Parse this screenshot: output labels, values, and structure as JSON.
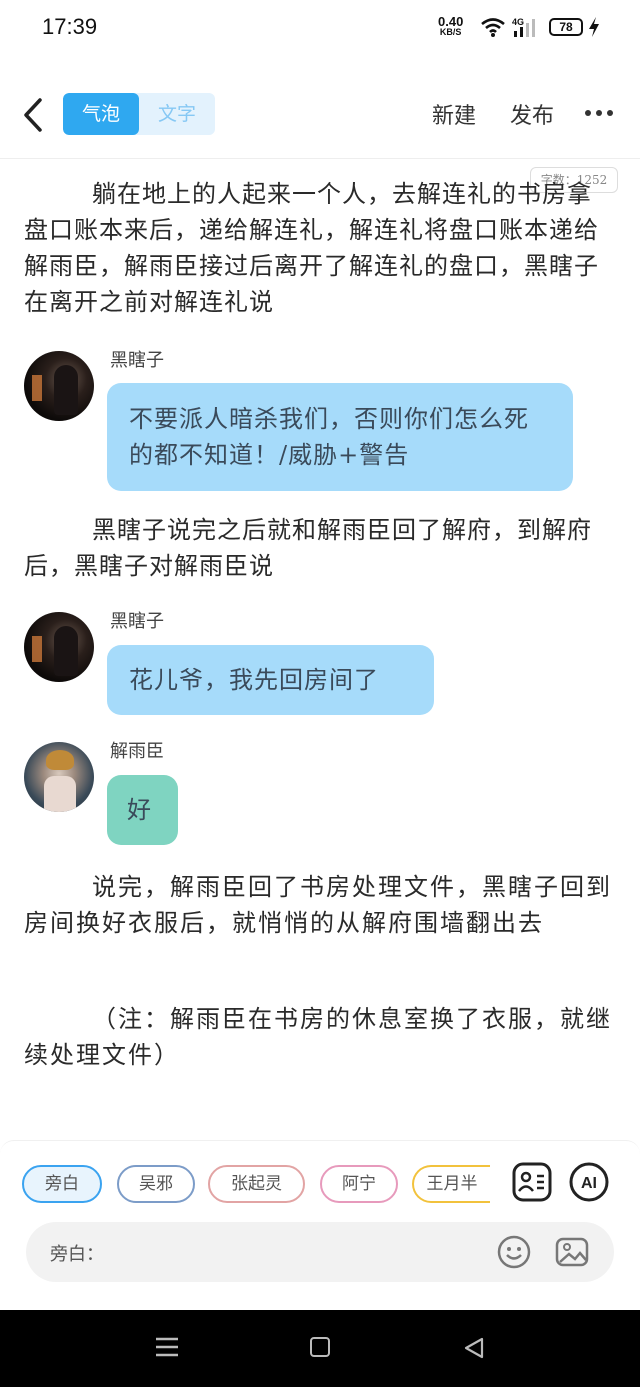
{
  "status_bar": {
    "time": "17:39",
    "net_speed": "0.40",
    "net_unit": "KB/S",
    "net_type": "4G",
    "battery": "78"
  },
  "header": {
    "tab_bubble": "气泡",
    "tab_text": "文字",
    "new_label": "新建",
    "publish_label": "发布"
  },
  "word_count": "字数：1252",
  "content": {
    "para1": "躺在地上的人起来一个人，去解连礼的书房拿盘口账本来后，递给解连礼，解连礼将盘口账本递给解雨臣，解雨臣接过后离开了解连礼的盘口，黑瞎子在离开之前对解连礼说",
    "msg1": {
      "speaker": "黑瞎子",
      "text": "不要派人暗杀我们，否则你们怎么死的都不知道！/威胁+警告"
    },
    "para2": "黑瞎子说完之后就和解雨臣回了解府，到解府后，黑瞎子对解雨臣说",
    "msg2": {
      "speaker": "黑瞎子",
      "text": "花儿爷，我先回房间了"
    },
    "msg3": {
      "speaker": "解雨臣",
      "text": "好"
    },
    "para3": "说完，解雨臣回了书房处理文件，黑瞎子回到房间换好衣服后，就悄悄的从解府围墙翻出去",
    "para4": "（注：解雨臣在书房的休息室换了衣服，就继续处理文件）"
  },
  "toolbar": {
    "chips": [
      "旁白",
      "吴邪",
      "张起灵",
      "阿宁",
      "王月半"
    ],
    "ai_label": "AI",
    "input_label": "旁白：",
    "input_value": ""
  },
  "colors": {
    "accent": "#2fa8f0",
    "bubble_blue": "#a6dbfa",
    "bubble_green": "#7fd4c1"
  }
}
